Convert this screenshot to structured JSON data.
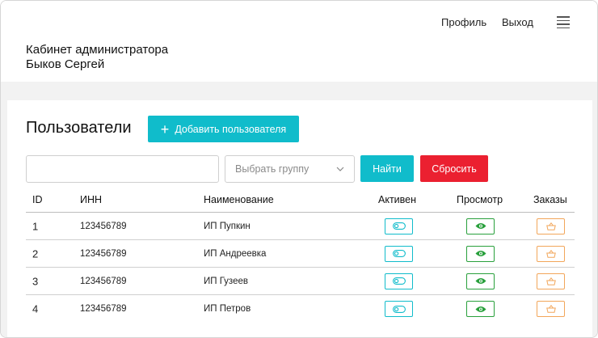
{
  "header": {
    "nav": {
      "profile": "Профиль",
      "logout": "Выход",
      "menu_icon": "hamburger-menu-icon"
    },
    "admin_title": "Кабинет администратора",
    "admin_name": "Быков Сергей"
  },
  "users": {
    "title": "Пользователи",
    "add_button": "Добавить пользователя",
    "filters": {
      "search_value": "",
      "search_placeholder": "",
      "group_placeholder": "Выбрать группу",
      "find_button": "Найти",
      "reset_button": "Сбросить"
    },
    "table": {
      "headers": {
        "id": "ID",
        "inn": "ИНН",
        "name": "Наименование",
        "active": "Активен",
        "view": "Просмотр",
        "orders": "Заказы"
      },
      "rows": [
        {
          "id": "1",
          "inn": "123456789",
          "name": "ИП Пупкин"
        },
        {
          "id": "2",
          "inn": "123456789",
          "name": "ИП Андреевка"
        },
        {
          "id": "3",
          "inn": "123456789",
          "name": "ИП Гузеев"
        },
        {
          "id": "4",
          "inn": "123456789",
          "name": "ИП Петров"
        }
      ]
    }
  },
  "colors": {
    "accent": "#10bccb",
    "danger": "#eb2030",
    "view_green": "#29a03c",
    "orders_orange": "#f2a65a"
  },
  "icons": {
    "active": "toggle-icon",
    "view": "eye-icon",
    "orders": "basket-icon",
    "add": "plus-icon",
    "select": "chevron-down-icon"
  }
}
